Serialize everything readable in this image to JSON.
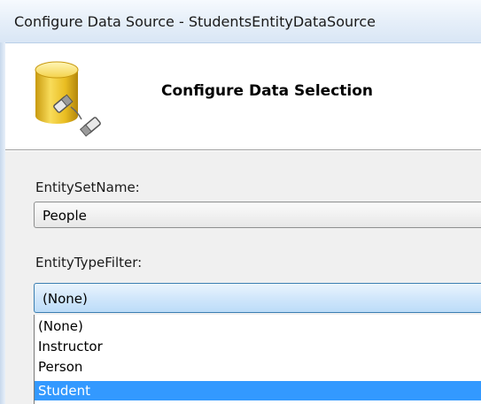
{
  "window": {
    "title": "Configure Data Source - StudentsEntityDataSource"
  },
  "header": {
    "heading": "Configure Data Selection",
    "icon": "database-icon"
  },
  "form": {
    "entity_set_label": "EntitySetName:",
    "entity_set_value": "People",
    "entity_type_label": "EntityTypeFilter:",
    "entity_type_value": "(None)"
  },
  "dropdown": {
    "options": [
      "(None)",
      "Instructor",
      "Person",
      "Student"
    ],
    "highlighted_index": 3
  },
  "colors": {
    "selection": "#3399ff",
    "focus_border": "#3c7fb1",
    "title_bar": "#dce8f6"
  }
}
